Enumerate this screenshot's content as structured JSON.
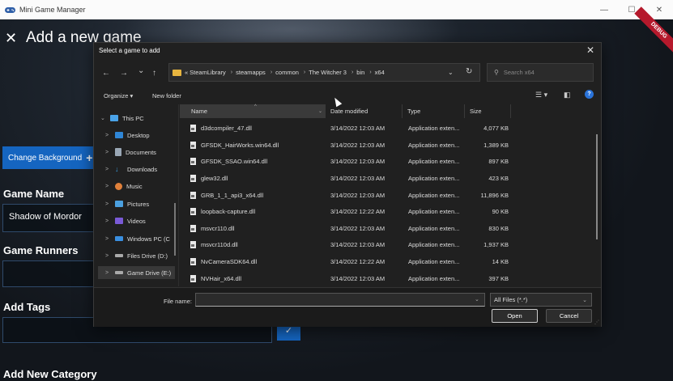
{
  "app": {
    "title": "Mini Game Manager",
    "window_controls": {
      "minimize": "—",
      "maximize": "☐",
      "close": "✕"
    },
    "debug_badge": "DEBUG"
  },
  "page": {
    "close": "✕",
    "title": "Add a new game",
    "change_background_label": "Change Background",
    "change_background_plus": "+",
    "game_name_label": "Game Name",
    "game_name_value": "Shadow of Mordor",
    "game_runners_label": "Game Runners",
    "add_tags_label": "Add Tags",
    "add_category_label": "Add New Category",
    "tag_confirm": "✓"
  },
  "dialog": {
    "title": "Select a game to add",
    "close": "✕",
    "nav": {
      "back": "←",
      "forward": "→",
      "dropdown": "⌄",
      "up": "↑",
      "refresh": "↻",
      "addr_dropdown": "⌄"
    },
    "address": {
      "prefix": "«",
      "segments": [
        "SteamLibrary",
        "steamapps",
        "common",
        "The Witcher 3",
        "bin",
        "x64"
      ]
    },
    "search_placeholder": "Search x64",
    "toolbar": {
      "organize": "Organize ▾",
      "new_folder": "New folder",
      "help": "?"
    },
    "nav_pane": [
      {
        "label": "This PC",
        "chev": "⌄",
        "color": "#4aa3e8"
      },
      {
        "label": "Desktop",
        "chev": ">",
        "color": "#2f86d6"
      },
      {
        "label": "Documents",
        "chev": ">",
        "color": "#9aa7b5"
      },
      {
        "label": "Downloads",
        "chev": ">",
        "color": "#3a9ad9"
      },
      {
        "label": "Music",
        "chev": ">",
        "color": "#e0803a"
      },
      {
        "label": "Pictures",
        "chev": ">",
        "color": "#4ba0e0"
      },
      {
        "label": "Videos",
        "chev": ">",
        "color": "#7a5ad6"
      },
      {
        "label": "Windows PC (C",
        "chev": ">",
        "color": "#3a8fe0"
      },
      {
        "label": "Files Drive (D:)",
        "chev": ">",
        "color": "#aaaaaa"
      },
      {
        "label": "Game Drive (E:)",
        "chev": ">",
        "color": "#aaaaaa"
      }
    ],
    "columns": {
      "name": "Name",
      "date": "Date modified",
      "type": "Type",
      "size": "Size"
    },
    "files": [
      {
        "name": "d3dcompiler_47.dll",
        "date": "3/14/2022 12:03 AM",
        "type": "Application exten...",
        "size": "4,077 KB"
      },
      {
        "name": "GFSDK_HairWorks.win64.dll",
        "date": "3/14/2022 12:03 AM",
        "type": "Application exten...",
        "size": "1,389 KB"
      },
      {
        "name": "GFSDK_SSAO.win64.dll",
        "date": "3/14/2022 12:03 AM",
        "type": "Application exten...",
        "size": "897 KB"
      },
      {
        "name": "glew32.dll",
        "date": "3/14/2022 12:03 AM",
        "type": "Application exten...",
        "size": "423 KB"
      },
      {
        "name": "GRB_1_1_api3_x64.dll",
        "date": "3/14/2022 12:03 AM",
        "type": "Application exten...",
        "size": "11,896 KB"
      },
      {
        "name": "loopback-capture.dll",
        "date": "3/14/2022 12:22 AM",
        "type": "Application exten...",
        "size": "90 KB"
      },
      {
        "name": "msvcr110.dll",
        "date": "3/14/2022 12:03 AM",
        "type": "Application exten...",
        "size": "830 KB"
      },
      {
        "name": "msvcr110d.dll",
        "date": "3/14/2022 12:03 AM",
        "type": "Application exten...",
        "size": "1,937 KB"
      },
      {
        "name": "NvCameraSDK64.dll",
        "date": "3/14/2022 12:22 AM",
        "type": "Application exten...",
        "size": "14 KB"
      },
      {
        "name": "NVHair_x64.dll",
        "date": "3/14/2022 12:03 AM",
        "type": "Application exten...",
        "size": "397 KB"
      }
    ],
    "file_name_label": "File name:",
    "file_name_value": "",
    "filter_value": "All Files (*.*)",
    "open_label": "Open",
    "cancel_label": "Cancel"
  }
}
